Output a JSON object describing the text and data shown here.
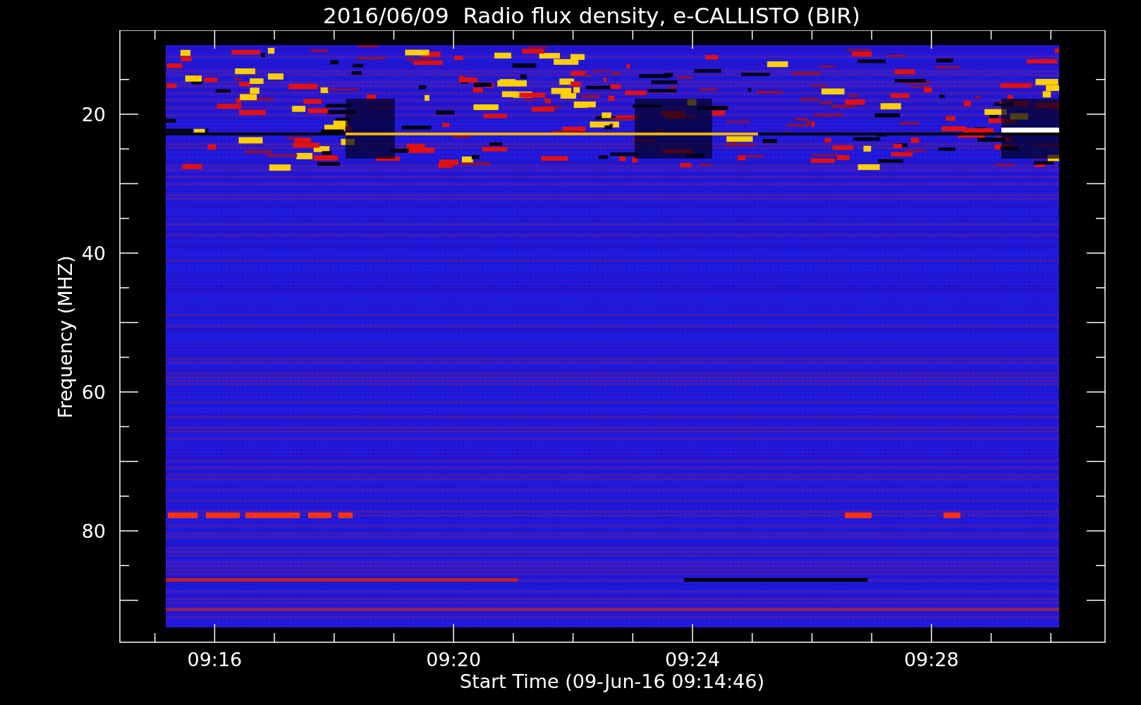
{
  "title": "2016/06/09  Radio flux density, e-CALLISTO (BIR)",
  "y_axis": {
    "label": "Frequency (MHZ)",
    "ticks": [
      "20",
      "40",
      "60",
      "80"
    ]
  },
  "x_axis": {
    "label": "Start Time (09-Jun-16 09:14:46)",
    "ticks": [
      "09:16",
      "09:20",
      "09:24",
      "09:28"
    ]
  }
}
